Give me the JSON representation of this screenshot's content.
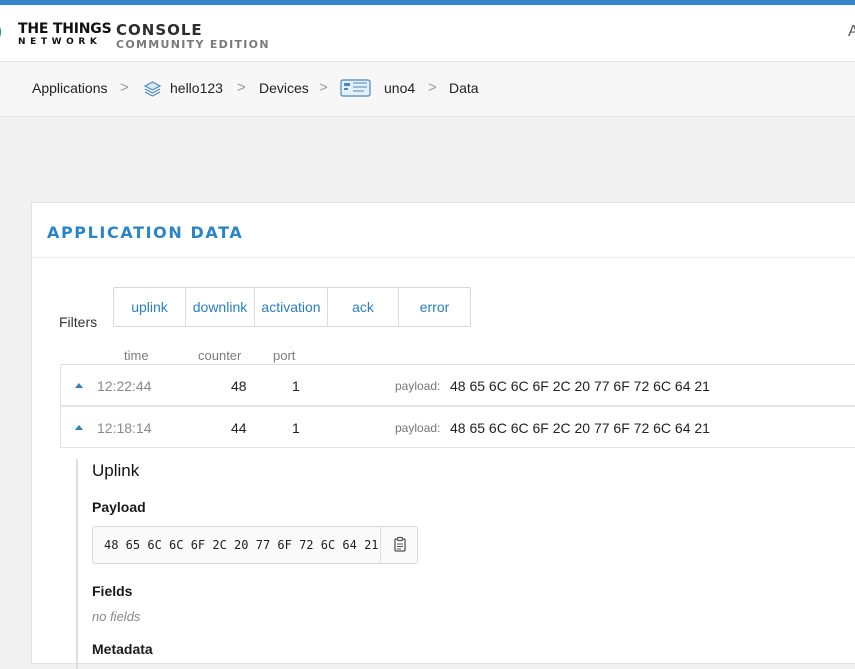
{
  "header": {
    "brand_line1": "THE THINGS",
    "brand_line2": "NETWORK",
    "console_title": "CONSOLE",
    "console_subtitle": "COMMUNITY EDITION",
    "right_text": "A"
  },
  "breadcrumb": {
    "applications": "Applications",
    "app_name": "hello123",
    "devices": "Devices",
    "device_name": "uno4",
    "data": "Data",
    "separator": ">"
  },
  "card": {
    "title": "APPLICATION DATA",
    "filters_label": "Filters",
    "filters": [
      "uplink",
      "downlink",
      "activation",
      "ack",
      "error"
    ],
    "columns": {
      "time": "time",
      "counter": "counter",
      "port": "port"
    },
    "rows": [
      {
        "time": "12:22:44",
        "counter": "48",
        "port": "1",
        "payload_label": "payload:",
        "payload": "48 65 6C 6C 6F 2C 20 77 6F 72 6C 64 21"
      },
      {
        "time": "12:18:14",
        "counter": "44",
        "port": "1",
        "payload_label": "payload:",
        "payload": "48 65 6C 6C 6F 2C 20 77 6F 72 6C 64 21"
      }
    ],
    "detail": {
      "title": "Uplink",
      "payload_label": "Payload",
      "payload_value": "48 65 6C 6C 6F 2C 20 77 6F 72 6C 64 21",
      "fields_label": "Fields",
      "no_fields": "no fields",
      "metadata_label": "Metadata"
    }
  },
  "icons": {
    "app": "stack-icon",
    "device": "device-board-icon",
    "copy": "clipboard-icon",
    "expand": "caret-up-icon"
  },
  "colors": {
    "accent": "#2a85c7",
    "link": "#2a7fc0",
    "top_bar": "#3584c8"
  }
}
